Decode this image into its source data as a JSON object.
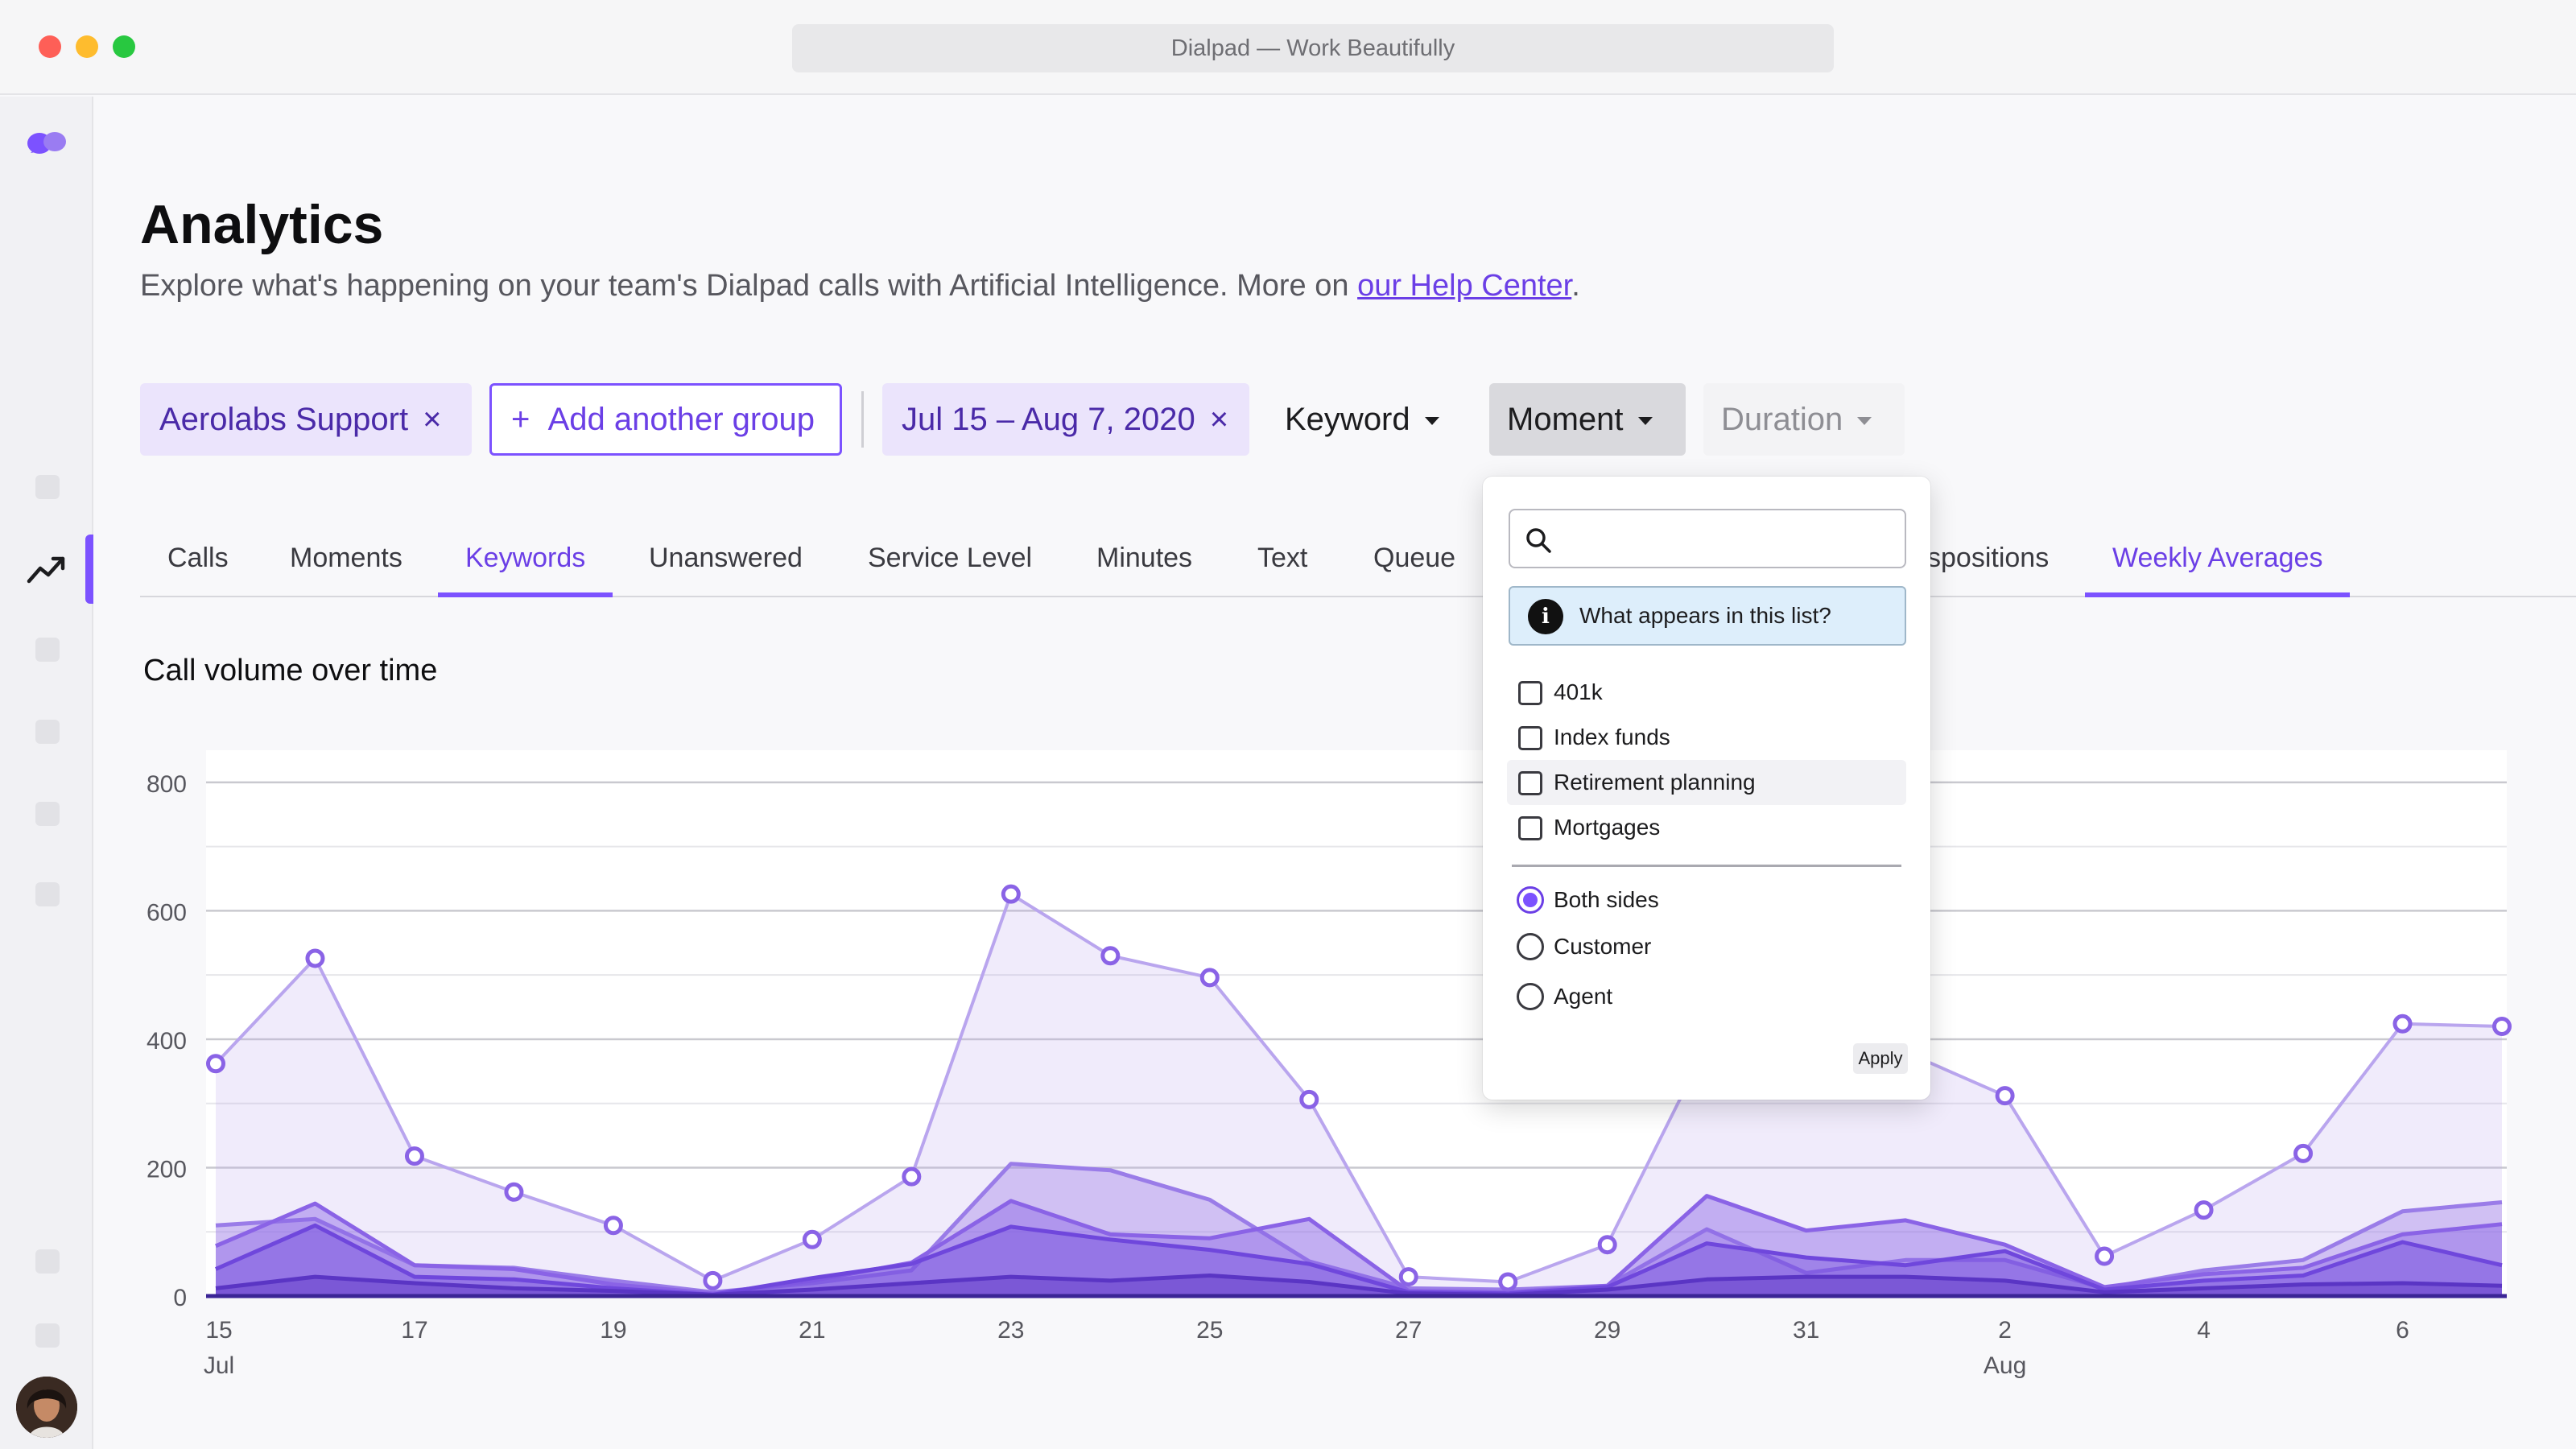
{
  "window": {
    "title": "Dialpad — Work Beautifully"
  },
  "header": {
    "title": "Analytics",
    "subtitle": "Explore what's happening on your team's Dialpad calls with Artificial Intelligence. More on ",
    "help_link": "our Help Center",
    "subtitle_end": "."
  },
  "filters": {
    "group": "Aerolabs Support",
    "add_group": "Add another group",
    "add_icon": "+",
    "date_range": "Jul 15 – Aug 7, 2020",
    "remove_icon": "×",
    "keyword": "Keyword",
    "moment": "Moment",
    "duration": "Duration"
  },
  "tabs": [
    {
      "label": "Calls"
    },
    {
      "label": "Moments"
    },
    {
      "label": "Keywords"
    },
    {
      "label": "Unanswered"
    },
    {
      "label": "Service Level"
    },
    {
      "label": "Minutes"
    },
    {
      "label": "Text"
    },
    {
      "label": "Queue"
    },
    {
      "label": "spositions"
    },
    {
      "label": "Weekly Averages"
    }
  ],
  "active_tabs": [
    "Keywords",
    "Weekly Averages"
  ],
  "popover": {
    "search_placeholder": "",
    "info": "What appears in this list?",
    "keywords": [
      {
        "label": "401k",
        "checked": false
      },
      {
        "label": "Index funds",
        "checked": false
      },
      {
        "label": "Retirement planning",
        "checked": false
      },
      {
        "label": "Mortgages",
        "checked": false
      }
    ],
    "sides": [
      {
        "label": "Both sides",
        "selected": true
      },
      {
        "label": "Customer",
        "selected": false
      },
      {
        "label": "Agent",
        "selected": false
      }
    ],
    "apply": "Apply"
  },
  "colors": {
    "accent": "#7c52ff",
    "series": [
      "#b9a5ee",
      "#9a7ce8",
      "#8a63e6",
      "#6f47dc",
      "#5a35c4"
    ]
  },
  "chart_data": {
    "type": "area",
    "title": "Call volume over time",
    "x": [
      "Jul 15",
      "Jul 16",
      "Jul 17",
      "Jul 18",
      "Jul 19",
      "Jul 20",
      "Jul 21",
      "Jul 22",
      "Jul 23",
      "Jul 24",
      "Jul 25",
      "Jul 26",
      "Jul 27",
      "Jul 28",
      "Jul 29",
      "Jul 30",
      "Jul 31",
      "Aug 1",
      "Aug 2",
      "Aug 3",
      "Aug 4",
      "Aug 5",
      "Aug 6",
      "Aug 7"
    ],
    "x_tick_labels": [
      "15",
      "17",
      "19",
      "21",
      "23",
      "25",
      "27",
      "29",
      "31",
      "2",
      "4",
      "6"
    ],
    "x_tick_days": [
      0,
      2,
      4,
      6,
      8,
      10,
      12,
      14,
      16,
      18,
      20,
      22
    ],
    "month_labels": [
      {
        "label": "Jul",
        "day": 0
      },
      {
        "label": "Aug",
        "day": 18
      }
    ],
    "y_ticks": [
      0,
      200,
      400,
      600,
      800
    ],
    "ylim": [
      0,
      850
    ],
    "grid": true,
    "series": [
      {
        "values": [
          362,
          526,
          218,
          162,
          110,
          24,
          88,
          186,
          626,
          530,
          496,
          306,
          30,
          22,
          80,
          390,
          420,
          380,
          312,
          62,
          134,
          222,
          424,
          420
        ],
        "markers": true
      },
      {
        "values": [
          110,
          120,
          48,
          44,
          24,
          6,
          20,
          40,
          206,
          196,
          150,
          54,
          12,
          10,
          16,
          104,
          36,
          56,
          56,
          12,
          40,
          56,
          132,
          146
        ],
        "markers": false
      },
      {
        "values": [
          78,
          144,
          48,
          42,
          18,
          4,
          24,
          52,
          148,
          96,
          90,
          120,
          8,
          6,
          16,
          156,
          102,
          118,
          80,
          14,
          34,
          44,
          96,
          112
        ],
        "markers": false
      },
      {
        "values": [
          42,
          110,
          30,
          26,
          12,
          2,
          28,
          50,
          108,
          88,
          72,
          50,
          6,
          4,
          14,
          82,
          60,
          48,
          70,
          10,
          24,
          32,
          84,
          48
        ],
        "markers": false
      },
      {
        "values": [
          12,
          30,
          20,
          12,
          8,
          2,
          10,
          20,
          30,
          24,
          32,
          22,
          4,
          2,
          10,
          26,
          30,
          30,
          24,
          6,
          12,
          18,
          20,
          16
        ],
        "markers": false
      }
    ]
  }
}
